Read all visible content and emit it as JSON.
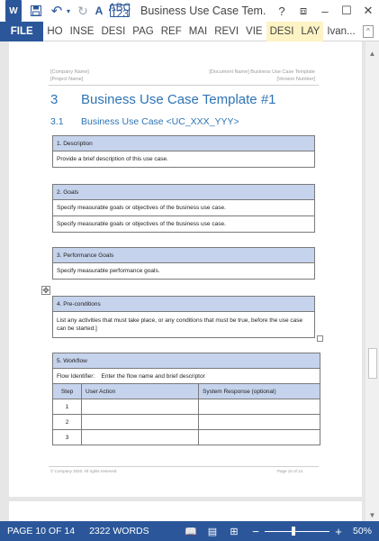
{
  "titlebar": {
    "app_icon": "W",
    "abc_line1": "ABC",
    "abc_line2": "123",
    "title": "Business Use Case Tem...",
    "help": "?",
    "restore": "⧈",
    "minimize": "–",
    "maximize": "☐",
    "close": "✕"
  },
  "ribbon": {
    "tabs": [
      "FILE",
      "HO",
      "INSE",
      "DESI",
      "PAG",
      "REF",
      "MAI",
      "REVI",
      "VIE",
      "DESI",
      "LAY"
    ],
    "user": "Ivan...",
    "collapse": "^"
  },
  "document": {
    "header_left": [
      "[Company Name]",
      "[Project Name]"
    ],
    "header_right": [
      "[Document Name] Business Use Case Template",
      "[Version Number]"
    ],
    "heading1_num": "3",
    "heading1": "Business Use Case Template #1",
    "heading2_num": "3.1",
    "heading2": "Business Use Case <UC_XXX_YYY>",
    "description": {
      "head": "1. Description",
      "text": "Provide a brief description of this use case."
    },
    "goals": {
      "head": "2. Goals",
      "items": [
        "Specify measurable goals or objectives of the business use case.",
        "Specify measurable goals or objectives of the business use case."
      ]
    },
    "performance": {
      "head": "3. Performance Goals",
      "text": "Specify measurable performance goals."
    },
    "preconditions": {
      "head": "4. Pre-conditions",
      "text": "List any activities that must take place, or any conditions that must be true, before the use case can be started.]"
    },
    "workflow": {
      "head": "5.  Workflow",
      "flow_label": "Flow Identifier:",
      "flow_value": "Enter the flow name and brief descriptor",
      "columns": [
        "Step",
        "User Action",
        "System Response (optional)"
      ],
      "steps": [
        "1",
        "2",
        "3"
      ]
    },
    "footer_left": "© Company 2020. All rights reserved",
    "footer_right": "Page 10 of 14"
  },
  "status": {
    "page": "PAGE 10 OF 14",
    "words": "2322 WORDS",
    "zoom": "50%",
    "zoom_percent": 50
  },
  "colors": {
    "accent": "#2b579a",
    "table_head": "#c6d3ec",
    "heading": "#2e74b5"
  }
}
